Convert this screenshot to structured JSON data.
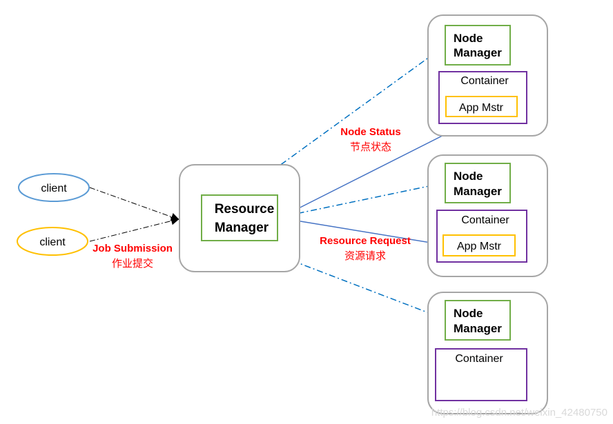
{
  "clients": [
    {
      "label": "client",
      "color": "#5b9bd5"
    },
    {
      "label": "client",
      "color": "#ffc000"
    }
  ],
  "resource_manager": {
    "line1": "Resource",
    "line2": "Manager"
  },
  "nodes": [
    {
      "nm_line1": "Node",
      "nm_line2": "Manager",
      "container": "Container",
      "app_master": "App Mstr"
    },
    {
      "nm_line1": "Node",
      "nm_line2": "Manager",
      "container": "Container",
      "app_master": "App Mstr"
    },
    {
      "nm_line1": "Node",
      "nm_line2": "Manager",
      "container": "Container",
      "app_master": null
    }
  ],
  "labels": {
    "job_submission": "Job Submission",
    "job_submission_cn": "作业提交",
    "node_status": "Node Status",
    "node_status_cn": "节点状态",
    "resource_request": "Resource Request",
    "resource_request_cn": "资源请求"
  },
  "watermark": "https://blog.csdn.net/weixin_42480750",
  "colors": {
    "outer_box": "#a6a6a6",
    "manager_box": "#70ad47",
    "container_box": "#7030a0",
    "app_master_box": "#ffc000",
    "status_line": "#0070c0",
    "request_line": "#4472c4",
    "label_red": "#ff0000"
  }
}
